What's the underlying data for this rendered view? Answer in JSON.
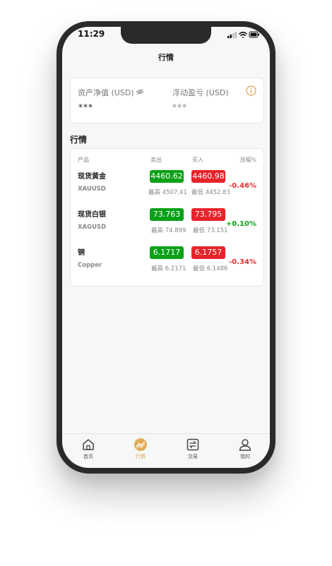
{
  "status_bar": {
    "time": "11:29"
  },
  "nav": {
    "title": "行情"
  },
  "assets": {
    "net_value_label": "资产净值 (USD)",
    "net_value": "***",
    "floating_pl_label": "浮动盈亏 (USD)",
    "floating_pl": "***"
  },
  "section_title": "行情",
  "table": {
    "headers": {
      "product": "产品",
      "sell": "卖出",
      "buy": "买入",
      "change": "涨幅%"
    },
    "rows": [
      {
        "name": "现货黄金",
        "code": "XAUUSD",
        "sell": "4460.62",
        "buy": "4460.98",
        "high": "最高 4507.41",
        "low": "最低 4452.83",
        "change": "-0.46%"
      },
      {
        "name": "现货白银",
        "code": "XAGUSD",
        "sell": "73.763",
        "buy": "73.795",
        "high": "最高 74.899",
        "low": "最低 73.151",
        "change": "+0.10%"
      },
      {
        "name": "铜",
        "code": "Copper",
        "sell": "6.1717",
        "buy": "6.1757",
        "high": "最高 6.2171",
        "low": "最低 6.1486",
        "change": "-0.34%"
      }
    ]
  },
  "tabbar": {
    "items": [
      {
        "label": "首页",
        "icon": "home-icon"
      },
      {
        "label": "行情",
        "icon": "market-icon",
        "active": true
      },
      {
        "label": "交易",
        "icon": "trade-icon"
      },
      {
        "label": "我的",
        "icon": "profile-icon"
      }
    ]
  },
  "colors": {
    "accent": "#d9a24c",
    "sell": "#0aa117",
    "buy": "#e8232b",
    "down": "#e8302f",
    "up": "#0aa117"
  }
}
